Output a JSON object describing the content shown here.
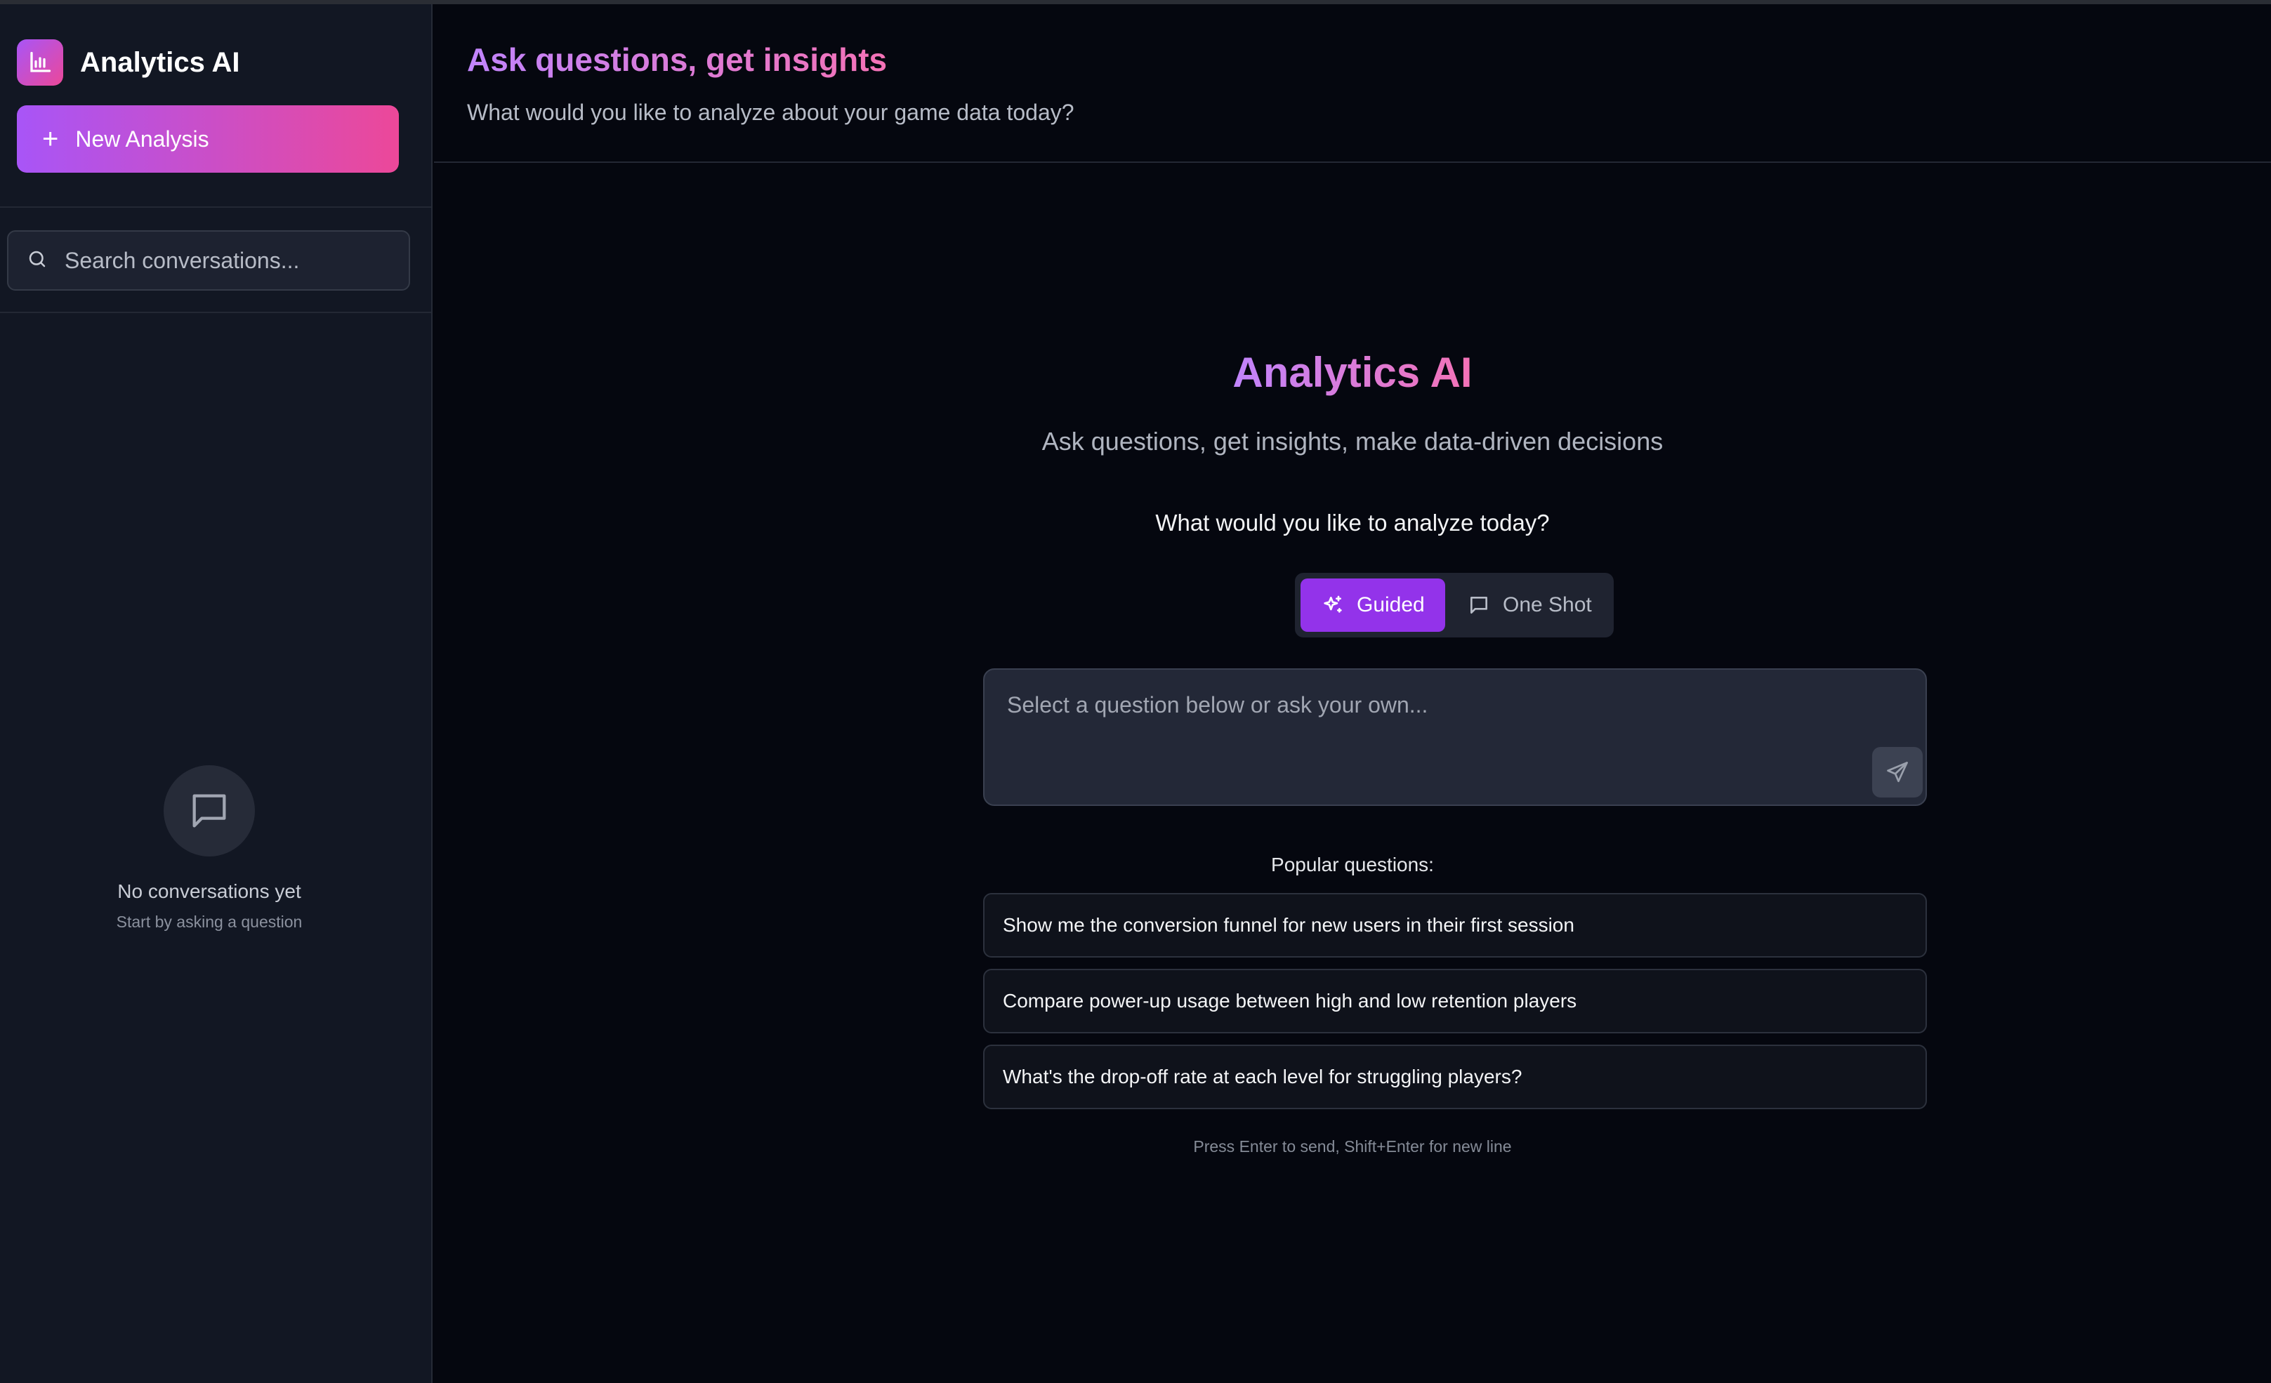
{
  "sidebar": {
    "brand_name": "Analytics AI",
    "new_button_label": "New Analysis",
    "search_placeholder": "Search conversations...",
    "empty_title": "No conversations yet",
    "empty_subtitle": "Start by asking a question"
  },
  "header": {
    "title": "Ask questions, get insights",
    "subtitle": "What would you like to analyze about your game data today?"
  },
  "hero": {
    "title": "Analytics AI",
    "subtitle": "Ask questions, get insights, make data-driven decisions",
    "prompt_label": "What would you like to analyze today?"
  },
  "modes": {
    "guided": "Guided",
    "one_shot": "One Shot",
    "selected": "Guided"
  },
  "input": {
    "placeholder": "Select a question below or ask your own..."
  },
  "popular": {
    "label": "Popular questions:",
    "questions": [
      "Show me the conversion funnel for new users in their first session",
      "Compare power-up usage between high and low retention players",
      "What's the drop-off rate at each level for struggling players?"
    ]
  },
  "hint": "Press Enter to send, Shift+Enter for new line",
  "icons": {
    "logo": "bar-chart-icon",
    "new": "plus-icon",
    "search": "search-icon",
    "empty": "message-square-icon",
    "guided": "sparkles-icon",
    "one_shot": "message-square-icon",
    "send": "send-icon"
  },
  "colors": {
    "accent_start": "#a855f7",
    "accent_end": "#ec4899",
    "guided_active": "#9333ea",
    "background": "#05070f",
    "sidebar": "#121723"
  }
}
